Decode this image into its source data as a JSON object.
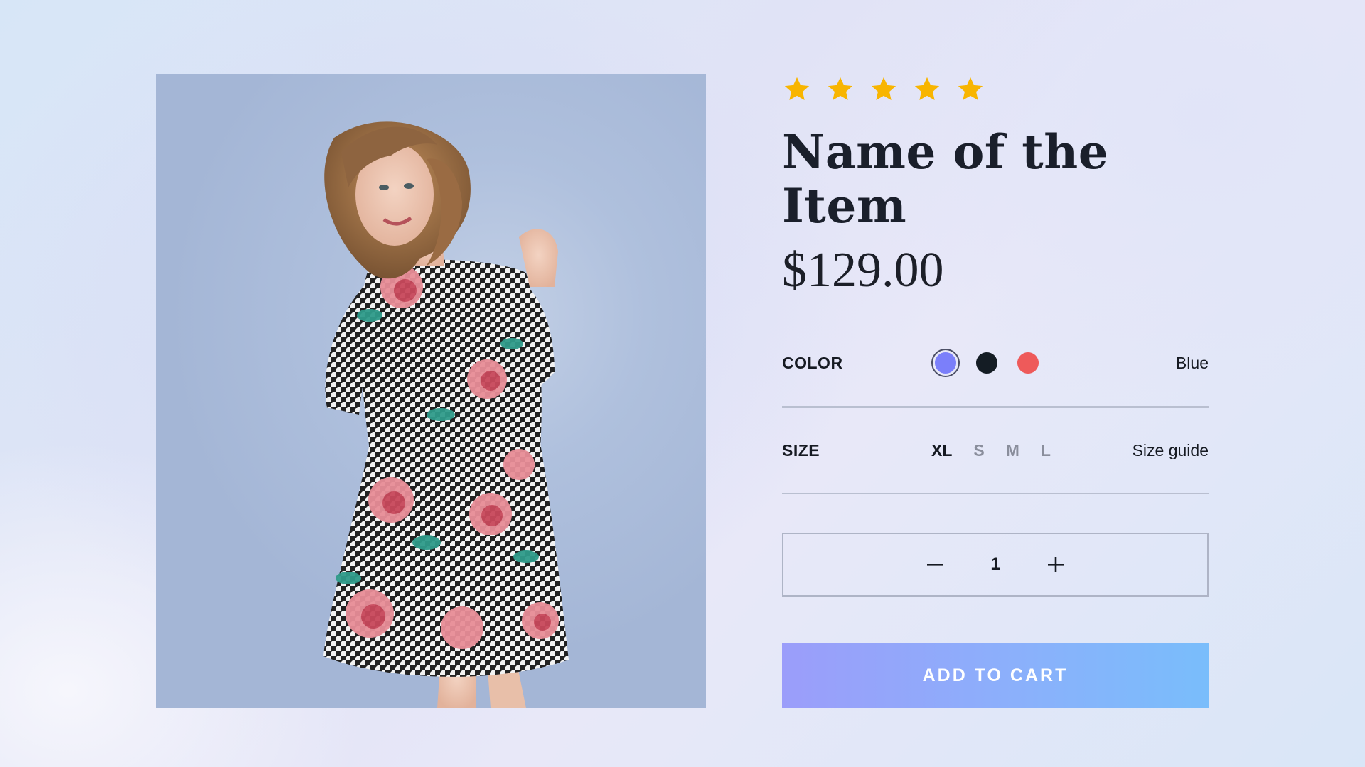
{
  "product": {
    "rating": 5,
    "rating_max": 5,
    "name": "Name of the Item",
    "price": "$129.00",
    "image_icon": "product-photo"
  },
  "color": {
    "label": "COLOR",
    "selected_name": "Blue",
    "options": [
      {
        "name": "blue",
        "hex": "#7b7ffa",
        "selected": true
      },
      {
        "name": "black",
        "hex": "#141c24",
        "selected": false
      },
      {
        "name": "red",
        "hex": "#ee5a5a",
        "selected": false
      }
    ]
  },
  "size": {
    "label": "SIZE",
    "options": [
      {
        "label": "XL",
        "selected": true
      },
      {
        "label": "S",
        "selected": false
      },
      {
        "label": "M",
        "selected": false
      },
      {
        "label": "L",
        "selected": false
      }
    ],
    "guide_link": "Size guide"
  },
  "quantity": {
    "value": "1",
    "decrement_icon": "minus-icon",
    "increment_icon": "plus-icon"
  },
  "cart": {
    "button_label": "ADD TO CART"
  },
  "colors": {
    "star": "#f8b500",
    "button_gradient_start": "#9b9dfa",
    "button_gradient_end": "#79bdfb",
    "text_dark": "#161a22",
    "size_inactive": "#8a8e9c"
  }
}
